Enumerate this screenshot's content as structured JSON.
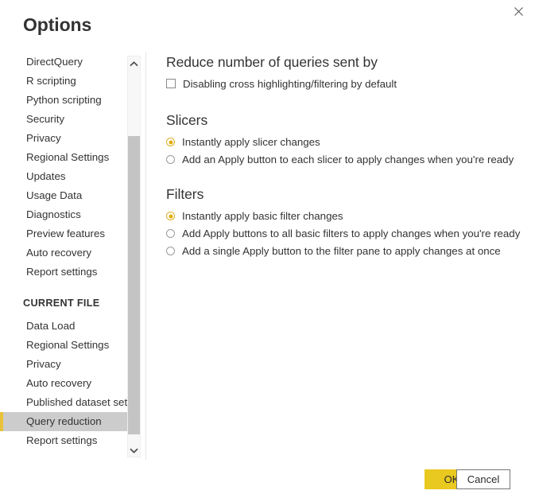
{
  "dialog": {
    "title": "Options",
    "close_icon": "close-icon"
  },
  "sidebar": {
    "global_items": [
      {
        "label": "DirectQuery"
      },
      {
        "label": "R scripting"
      },
      {
        "label": "Python scripting"
      },
      {
        "label": "Security"
      },
      {
        "label": "Privacy"
      },
      {
        "label": "Regional Settings"
      },
      {
        "label": "Updates"
      },
      {
        "label": "Usage Data"
      },
      {
        "label": "Diagnostics"
      },
      {
        "label": "Preview features"
      },
      {
        "label": "Auto recovery"
      },
      {
        "label": "Report settings"
      }
    ],
    "current_file_header": "CURRENT FILE",
    "current_file_items": [
      {
        "label": "Data Load",
        "selected": false
      },
      {
        "label": "Regional Settings",
        "selected": false
      },
      {
        "label": "Privacy",
        "selected": false
      },
      {
        "label": "Auto recovery",
        "selected": false
      },
      {
        "label": "Published dataset set...",
        "selected": false
      },
      {
        "label": "Query reduction",
        "selected": true
      },
      {
        "label": "Report settings",
        "selected": false
      }
    ],
    "scrollbar": {
      "up_icon": "chevron-up-icon",
      "down_icon": "chevron-down-icon"
    },
    "selected_accent_color": "#e8c23a",
    "selected_background_color": "#cccccc"
  },
  "content": {
    "reduce_heading": "Reduce number of queries sent by",
    "reduce_checkbox": {
      "label": "Disabling cross highlighting/filtering by default",
      "checked": false
    },
    "slicers_heading": "Slicers",
    "slicers_options": [
      {
        "label": "Instantly apply slicer changes",
        "checked": true
      },
      {
        "label": "Add an Apply button to each slicer to apply changes when you're ready",
        "checked": false
      }
    ],
    "filters_heading": "Filters",
    "filters_options": [
      {
        "label": "Instantly apply basic filter changes",
        "checked": true
      },
      {
        "label": "Add Apply buttons to all basic filters to apply changes when you're ready",
        "checked": false
      },
      {
        "label": "Add a single Apply button to the filter pane to apply changes at once",
        "checked": false
      }
    ],
    "radio_selected_color": "#e0ac00"
  },
  "footer": {
    "ok_label": "OK",
    "cancel_label": "Cancel",
    "ok_color": "#e9c81f"
  }
}
